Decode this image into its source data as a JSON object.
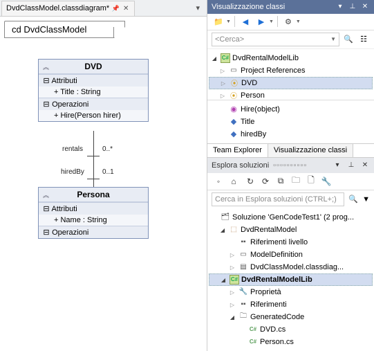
{
  "doc_tab": {
    "label": "DvdClassModel.classdiagram*"
  },
  "diagram": {
    "title": "cd DvdClassModel",
    "dvd": {
      "name": "DVD",
      "attr_head": "Attributi",
      "attr1": "+ Title : String",
      "op_head": "Operazioni",
      "op1": "+ Hire(Person hirer)"
    },
    "person": {
      "name": "Persona",
      "attr_head": "Attributi",
      "attr1": "+ Name : String",
      "op_head": "Operazioni"
    },
    "assoc": {
      "rentals_label": "rentals",
      "rentals_mult": "0..*",
      "hiredby_label": "hiredBy",
      "hiredby_mult": "0..1"
    }
  },
  "classview": {
    "panel_title": "Visualizzazione classi",
    "search_placeholder": "<Cerca>",
    "root": "DvdRentalModelLib",
    "n_projrefs": "Project References",
    "n_dvd": "DVD",
    "n_person": "Person",
    "m_hire": "Hire(object)",
    "m_title": "Title",
    "m_hiredby": "hiredBy",
    "tab_team": "Team Explorer",
    "tab_class": "Visualizzazione classi"
  },
  "solexp": {
    "title": "Esplora soluzioni",
    "search_placeholder": "Cerca in Esplora soluzioni (CTRL+;)",
    "sln": "Soluzione 'GenCodeTest1' (2 prog...",
    "proj1": "DvdRentalModel",
    "p1_refs": "Riferimenti livello",
    "p1_modeldef": "ModelDefinition",
    "p1_diagram": "DvdClassModel.classdiag...",
    "proj2": "DvdRentalModelLib",
    "p2_props": "Proprietà",
    "p2_refs": "Riferimenti",
    "p2_gen": "GeneratedCode",
    "p2_dvd": "DVD.cs",
    "p2_person": "Person.cs"
  }
}
